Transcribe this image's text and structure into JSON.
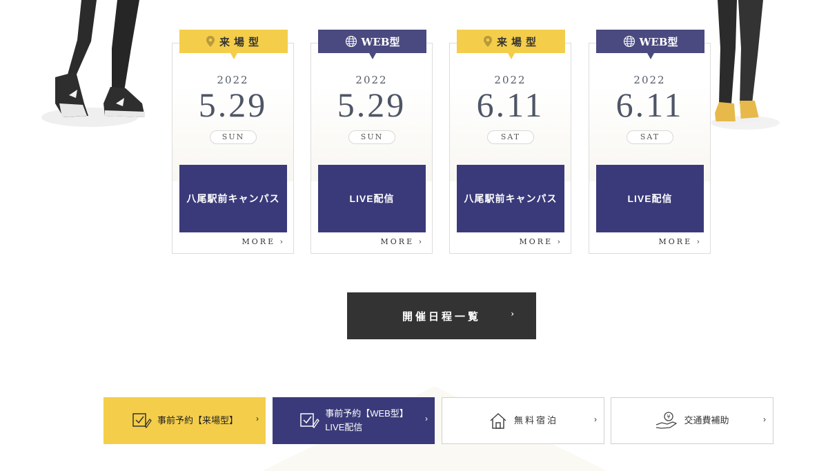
{
  "events": [
    {
      "type_label": "来場型",
      "type_style": "yellow",
      "type_icon": "location-pin-icon",
      "year": "2022",
      "date": "5.29",
      "weekday": "SUN",
      "venue": "八尾駅前キャンパス",
      "more": "MORE"
    },
    {
      "type_label": "WEB型",
      "type_style": "purple",
      "type_icon": "globe-icon",
      "year": "2022",
      "date": "5.29",
      "weekday": "SUN",
      "venue": "LIVE配信",
      "more": "MORE"
    },
    {
      "type_label": "来場型",
      "type_style": "yellow",
      "type_icon": "location-pin-icon",
      "year": "2022",
      "date": "6.11",
      "weekday": "SAT",
      "venue": "八尾駅前キャンパス",
      "more": "MORE"
    },
    {
      "type_label": "WEB型",
      "type_style": "purple",
      "type_icon": "globe-icon",
      "year": "2022",
      "date": "6.11",
      "weekday": "SAT",
      "venue": "LIVE配信",
      "more": "MORE"
    }
  ],
  "schedule_button": {
    "label": "開催日程一覧",
    "arrow": "›"
  },
  "bottom_nav": [
    {
      "line1": "事前予約【来場型】",
      "line2": "",
      "icon": "checklist-pen-icon",
      "arrow": "›"
    },
    {
      "line1": "事前予約【WEB型】",
      "line2": "LIVE配信",
      "icon": "checklist-pen-icon",
      "arrow": "›"
    },
    {
      "line1": "無料宿泊",
      "line2": "",
      "icon": "house-icon",
      "arrow": "›"
    },
    {
      "line1": "交通費補助",
      "line2": "",
      "icon": "hand-coin-icon",
      "arrow": "›"
    }
  ],
  "colors": {
    "yellow": "#f4ce4a",
    "purple": "#3a3a7a",
    "tag_purple": "#4a4a80",
    "dark": "#333333"
  }
}
